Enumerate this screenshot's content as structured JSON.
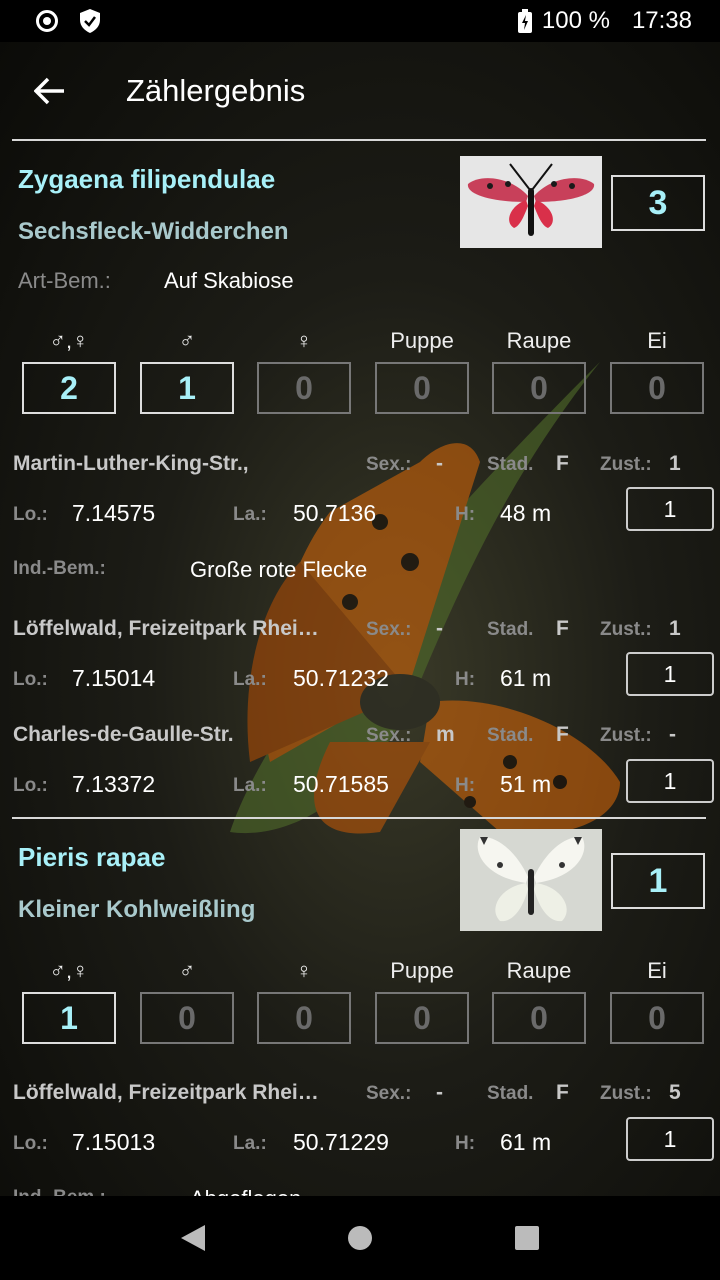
{
  "status_bar": {
    "battery": "100 %",
    "time": "17:38"
  },
  "app_bar": {
    "title": "Zählergebnis"
  },
  "sex_headers": [
    "♂,♀",
    "♂",
    "♀",
    "Puppe",
    "Raupe",
    "Ei"
  ],
  "labels": {
    "art_bem": "Art-Bem.:",
    "ind_bem": "Ind.-Bem.:",
    "sex": "Sex.:",
    "stad": "Stad.",
    "zust": "Zust.:",
    "lo": "Lo.:",
    "la": "La.:",
    "h": "H:"
  },
  "species": [
    {
      "scientific_name": "Zygaena filipendulae",
      "common_name": "Sechsfleck-Widderchen",
      "count": "3",
      "art_bem": "Auf Skabiose",
      "sex_counts": [
        "2",
        "1",
        "0",
        "0",
        "0",
        "0"
      ],
      "records": [
        {
          "location": "Martin-Luther-King-Str.,",
          "sex": "-",
          "stad": "F",
          "zust": "1",
          "lo": "7.14575",
          "la": "50.7136",
          "h": "48 m",
          "count": "1",
          "ind_bem": "Große rote Flecke"
        },
        {
          "location": "Löffelwald, Freizeitpark Rhei…",
          "sex": "-",
          "stad": "F",
          "zust": "1",
          "lo": "7.15014",
          "la": "50.71232",
          "h": "61 m",
          "count": "1"
        },
        {
          "location": "Charles-de-Gaulle-Str.",
          "sex": "m",
          "stad": "F",
          "zust": "-",
          "lo": "7.13372",
          "la": "50.71585",
          "h": "51 m",
          "count": "1"
        }
      ]
    },
    {
      "scientific_name": "Pieris rapae",
      "common_name": "Kleiner Kohlweißling",
      "count": "1",
      "sex_counts": [
        "1",
        "0",
        "0",
        "0",
        "0",
        "0"
      ],
      "records": [
        {
          "location": "Löffelwald, Freizeitpark Rhei…",
          "sex": "-",
          "stad": "F",
          "zust": "5",
          "lo": "7.15013",
          "la": "50.71229",
          "h": "61 m",
          "count": "1",
          "ind_bem": "Abgeflogen"
        }
      ]
    }
  ]
}
